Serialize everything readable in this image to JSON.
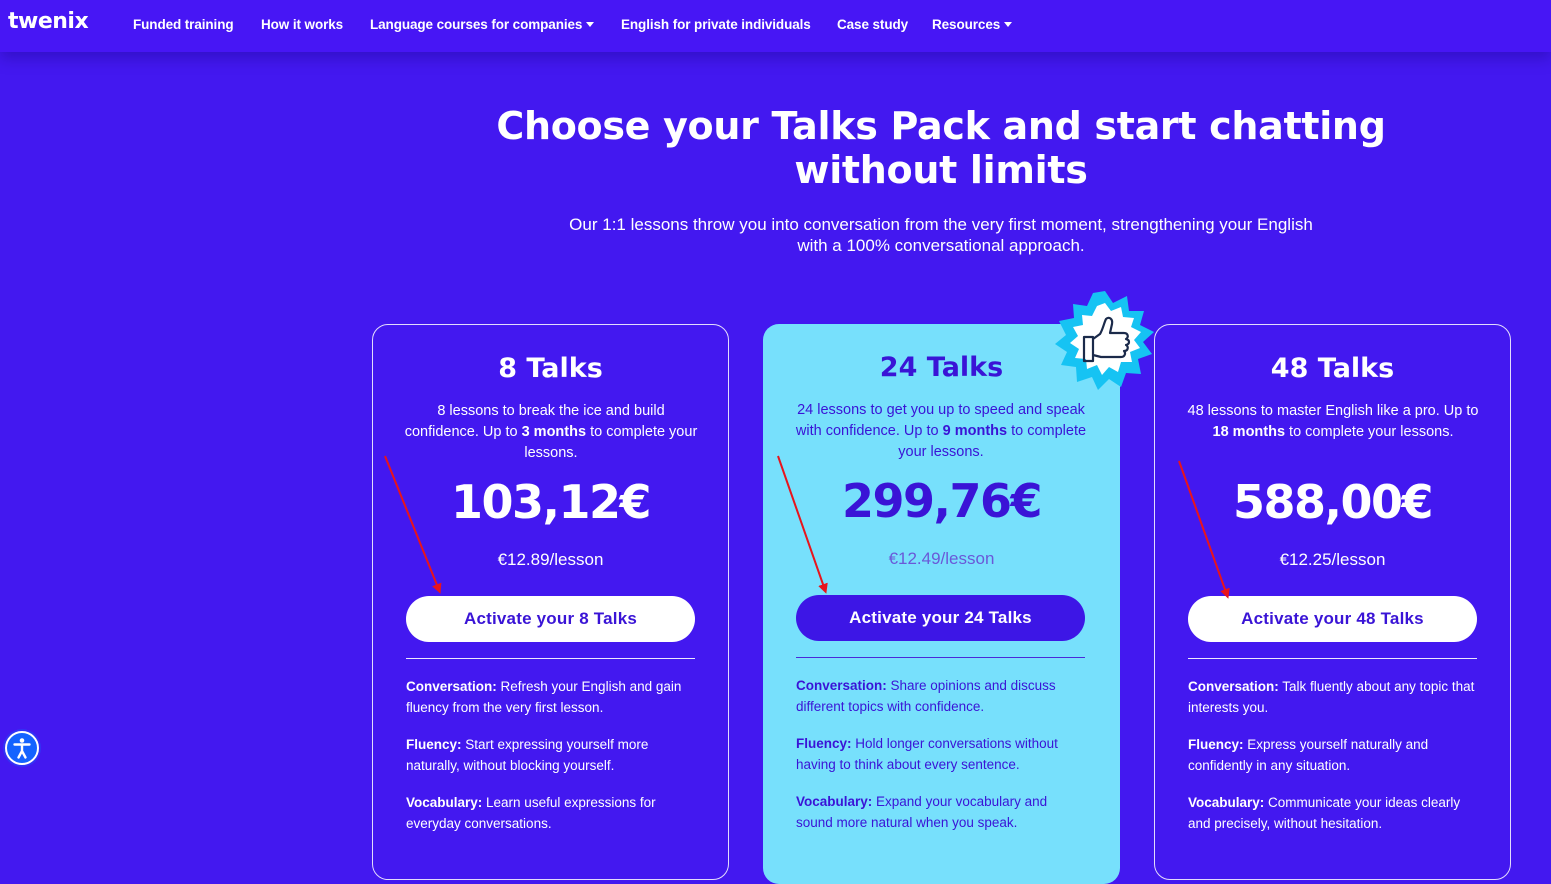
{
  "brand": {
    "logo": "twenix"
  },
  "nav": {
    "items": [
      {
        "label": "Funded training",
        "dropdown": false
      },
      {
        "label": "How it works",
        "dropdown": false
      },
      {
        "label": "Language courses for companies",
        "dropdown": true
      },
      {
        "label": "English for private individuals",
        "dropdown": false
      },
      {
        "label": "Case study",
        "dropdown": false
      },
      {
        "label": "Resources",
        "dropdown": true
      }
    ]
  },
  "hero": {
    "title_line1": "Choose your Talks Pack and start chatting",
    "title_line2": "without limits",
    "subtitle_line1": "Our 1:1 lessons throw you into conversation from the very first moment, strengthening your English",
    "subtitle_line2": "with a 100% conversational approach."
  },
  "plans": [
    {
      "title": "8 Talks",
      "desc_pre": "8 lessons to break the ice and build confidence. Up to ",
      "desc_bold": "3 months",
      "desc_post": " to complete your lessons.",
      "price": "103,12€",
      "per_lesson": "€12.89/lesson",
      "cta": "Activate your 8 Talks",
      "features": [
        {
          "label": "Conversation:",
          "text": " Refresh your English and gain fluency from the very first lesson."
        },
        {
          "label": "Fluency:",
          "text": " Start expressing yourself more naturally, without blocking yourself."
        },
        {
          "label": "Vocabulary:",
          "text": " Learn useful expressions for everyday conversations."
        }
      ]
    },
    {
      "title": "24 Talks",
      "desc_pre": "24 lessons to get you up to speed and speak with confidence. Up to ",
      "desc_bold": "9 months",
      "desc_post": " to complete your lessons.",
      "price": "299,76€",
      "per_lesson": "€12.49/lesson",
      "cta": "Activate your 24 Talks",
      "features": [
        {
          "label": "Conversation:",
          "text": " Share opinions and discuss different topics with confidence."
        },
        {
          "label": "Fluency:",
          "text": " Hold longer conversations without having to think about every sentence."
        },
        {
          "label": "Vocabulary:",
          "text": " Expand your vocabulary and sound more natural when you speak."
        }
      ]
    },
    {
      "title": "48 Talks",
      "desc_pre": "48 lessons to master English like a pro. Up to ",
      "desc_bold": "18 months",
      "desc_post": " to complete your lessons.",
      "price": "588,00€",
      "per_lesson": "€12.25/lesson",
      "cta": "Activate your 48 Talks",
      "features": [
        {
          "label": "Conversation:",
          "text": " Talk fluently about any topic that interests you."
        },
        {
          "label": "Fluency:",
          "text": " Express yourself naturally and confidently in any situation."
        },
        {
          "label": "Vocabulary:",
          "text": " Communicate your ideas clearly and precisely, without hesitation."
        }
      ]
    }
  ],
  "badge": {
    "icon": "thumbs-up-icon"
  },
  "accessibility": {
    "icon": "accessibility-icon"
  },
  "colors": {
    "background": "#4318f0",
    "featured_card": "#77e0fc",
    "accent_text": "#3a14d6",
    "annotation_arrow": "#e8141c"
  }
}
